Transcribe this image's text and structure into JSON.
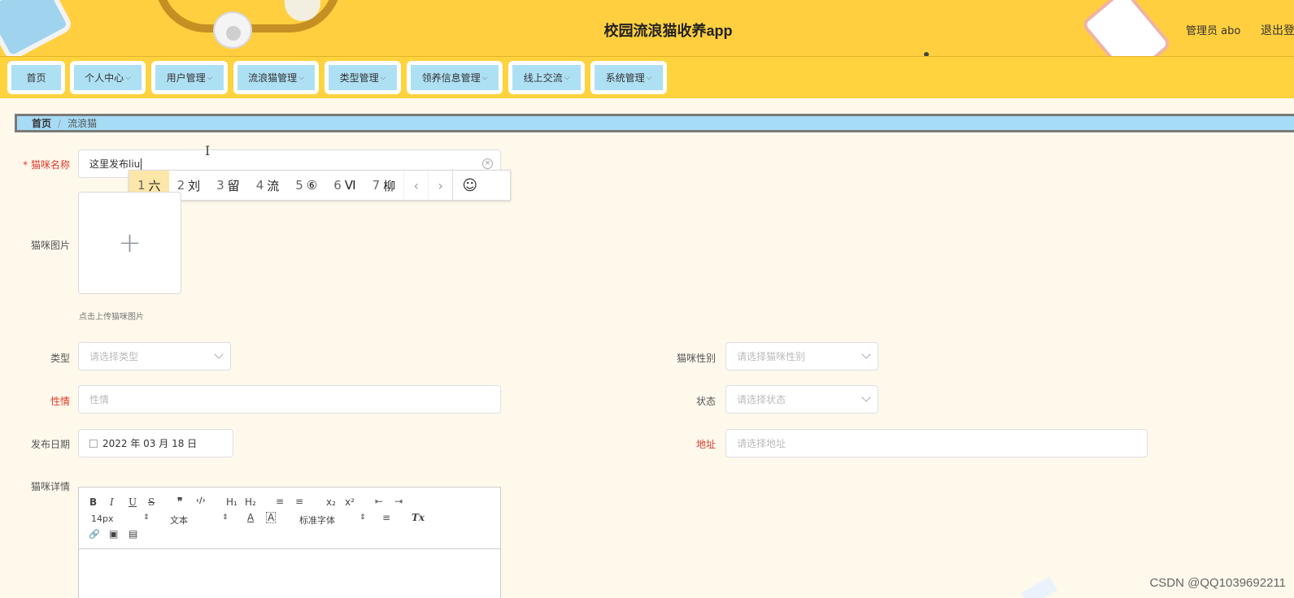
{
  "header": {
    "title": "校园流浪猫收养app",
    "admin": "管理员 abo",
    "logout": "退出登"
  },
  "nav": {
    "items": [
      {
        "label": "首页",
        "dropdown": false
      },
      {
        "label": "个人中心",
        "dropdown": true
      },
      {
        "label": "用户管理",
        "dropdown": true
      },
      {
        "label": "流浪猫管理",
        "dropdown": true
      },
      {
        "label": "类型管理",
        "dropdown": true
      },
      {
        "label": "领养信息管理",
        "dropdown": true
      },
      {
        "label": "线上交流",
        "dropdown": true
      },
      {
        "label": "系统管理",
        "dropdown": true
      }
    ]
  },
  "breadcrumb": {
    "home": "首页",
    "sep": "/",
    "current": "流浪猫"
  },
  "form": {
    "cat_name_label": "* 猫咪名称",
    "cat_name_value": "这里发布liu",
    "cat_image_label": "猫咪图片",
    "upload_plus": "+",
    "upload_tip": "点击上传猫咪图片",
    "type_label": "类型",
    "type_placeholder": "请选择类型",
    "gender_label": "猫咪性别",
    "gender_placeholder": "请选择猫咪性别",
    "temper_label": "性情",
    "temper_placeholder": "性情",
    "status_label": "状态",
    "status_placeholder": "请选择状态",
    "date_label": "发布日期",
    "date_value": "2022 年 03 月 18 日",
    "address_label": "地址",
    "address_placeholder": "请选择地址",
    "detail_label": "猫咪详情"
  },
  "ime": {
    "candidates": [
      {
        "num": "1",
        "text": "六"
      },
      {
        "num": "2",
        "text": "刘"
      },
      {
        "num": "3",
        "text": "留"
      },
      {
        "num": "4",
        "text": "流"
      },
      {
        "num": "5",
        "text": "⑥"
      },
      {
        "num": "6",
        "text": "Ⅵ"
      },
      {
        "num": "7",
        "text": "柳"
      }
    ],
    "prev": "‹",
    "next": "›",
    "emoji": "☺"
  },
  "editor": {
    "bold": "B",
    "italic": "I",
    "underline": "U",
    "strike": "S",
    "quote": "❞",
    "code": "‹/›",
    "h1": "H₁",
    "h2": "H₂",
    "ol": "≡",
    "ul": "≡",
    "sub": "x₂",
    "sup": "x²",
    "outdent": "⇤",
    "indent": "⇥",
    "size": "14px",
    "header_sel": "文本",
    "font": "标准字体",
    "color": "A",
    "bg": "A",
    "align": "≡",
    "clean": "Tx",
    "link": "🔗",
    "image": "▣",
    "video": "▤"
  },
  "watermark": "CSDN @QQ1039692211"
}
